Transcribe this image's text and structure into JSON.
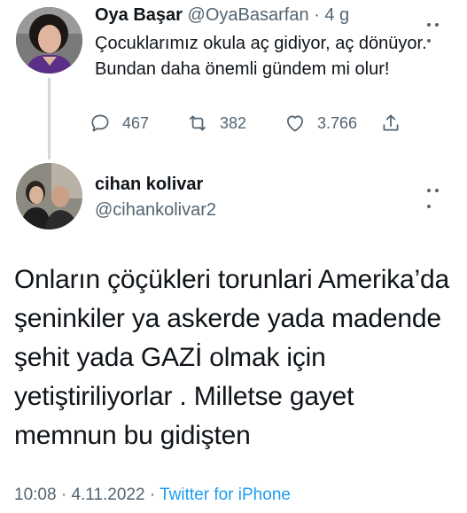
{
  "parent_tweet": {
    "display_name": "Oya Başar",
    "handle": "@OyaBasarfan",
    "separator": "·",
    "age": "4 g",
    "text": "Çocuklarımız okula aç gidiyor, aç dönüyor. Bundan daha önemli gündem mi olur!",
    "actions": {
      "reply_count": "467",
      "retweet_count": "382",
      "like_count": "3.766"
    },
    "icons": [
      "reply-icon",
      "retweet-icon",
      "like-icon",
      "share-icon",
      "more-icon"
    ]
  },
  "main_tweet": {
    "display_name": "cihan kolivar",
    "handle": "@cihankolivar2",
    "text": "Onların çöçükleri torunlari Amerika’da şeninkiler ya askerde yada madende şehit yada GAZİ olmak için yetiştiriliyorlar . Milletse gayet memnun bu gidişten",
    "time": "10:08",
    "dot": "·",
    "date": "4.11.2022",
    "dot2": "·",
    "source": "Twitter for iPhone"
  },
  "colors": {
    "text_primary": "#0f1419",
    "text_secondary": "#536471",
    "link": "#1d9bf0",
    "thread_line": "#cfd9de"
  }
}
